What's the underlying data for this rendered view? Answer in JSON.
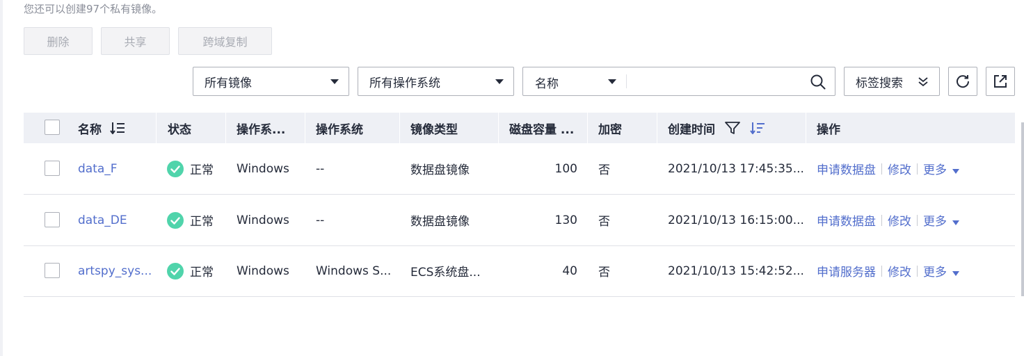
{
  "quota_text": "您还可以创建97个私有镜像。",
  "toolbar": {
    "delete_label": "删除",
    "share_label": "共享",
    "cross_region_copy_label": "跨域复制"
  },
  "filters": {
    "image_filter": "所有镜像",
    "os_filter": "所有操作系统",
    "search_field": "名称",
    "search_placeholder": "",
    "tag_search_label": "标签搜索"
  },
  "table": {
    "headers": {
      "name": "名称",
      "status": "状态",
      "os_type": "操作系...",
      "os": "操作系统",
      "image_type": "镜像类型",
      "disk_capacity": "磁盘容量 ...",
      "encrypted": "加密",
      "created_at": "创建时间",
      "actions": "操作"
    },
    "rows": [
      {
        "name": "data_F",
        "status": "正常",
        "os_type": "Windows",
        "os": "--",
        "image_type": "数据盘镜像",
        "disk_capacity": "100",
        "encrypted": "否",
        "created_at": "2021/10/13 17:45:35...",
        "action_primary": "申请数据盘",
        "action_modify": "修改",
        "action_more": "更多"
      },
      {
        "name": "data_DE",
        "status": "正常",
        "os_type": "Windows",
        "os": "--",
        "image_type": "数据盘镜像",
        "disk_capacity": "130",
        "encrypted": "否",
        "created_at": "2021/10/13 16:15:00...",
        "action_primary": "申请数据盘",
        "action_modify": "修改",
        "action_more": "更多"
      },
      {
        "name": "artspy_sys...",
        "status": "正常",
        "os_type": "Windows",
        "os": "Windows S...",
        "image_type": "ECS系统盘...",
        "disk_capacity": "40",
        "encrypted": "否",
        "created_at": "2021/10/13 15:42:52...",
        "action_primary": "申请服务器",
        "action_modify": "修改",
        "action_more": "更多"
      }
    ]
  },
  "colors": {
    "link": "#526ecc",
    "status_ok": "#50d4ab",
    "header_bg": "#eef0f5"
  }
}
